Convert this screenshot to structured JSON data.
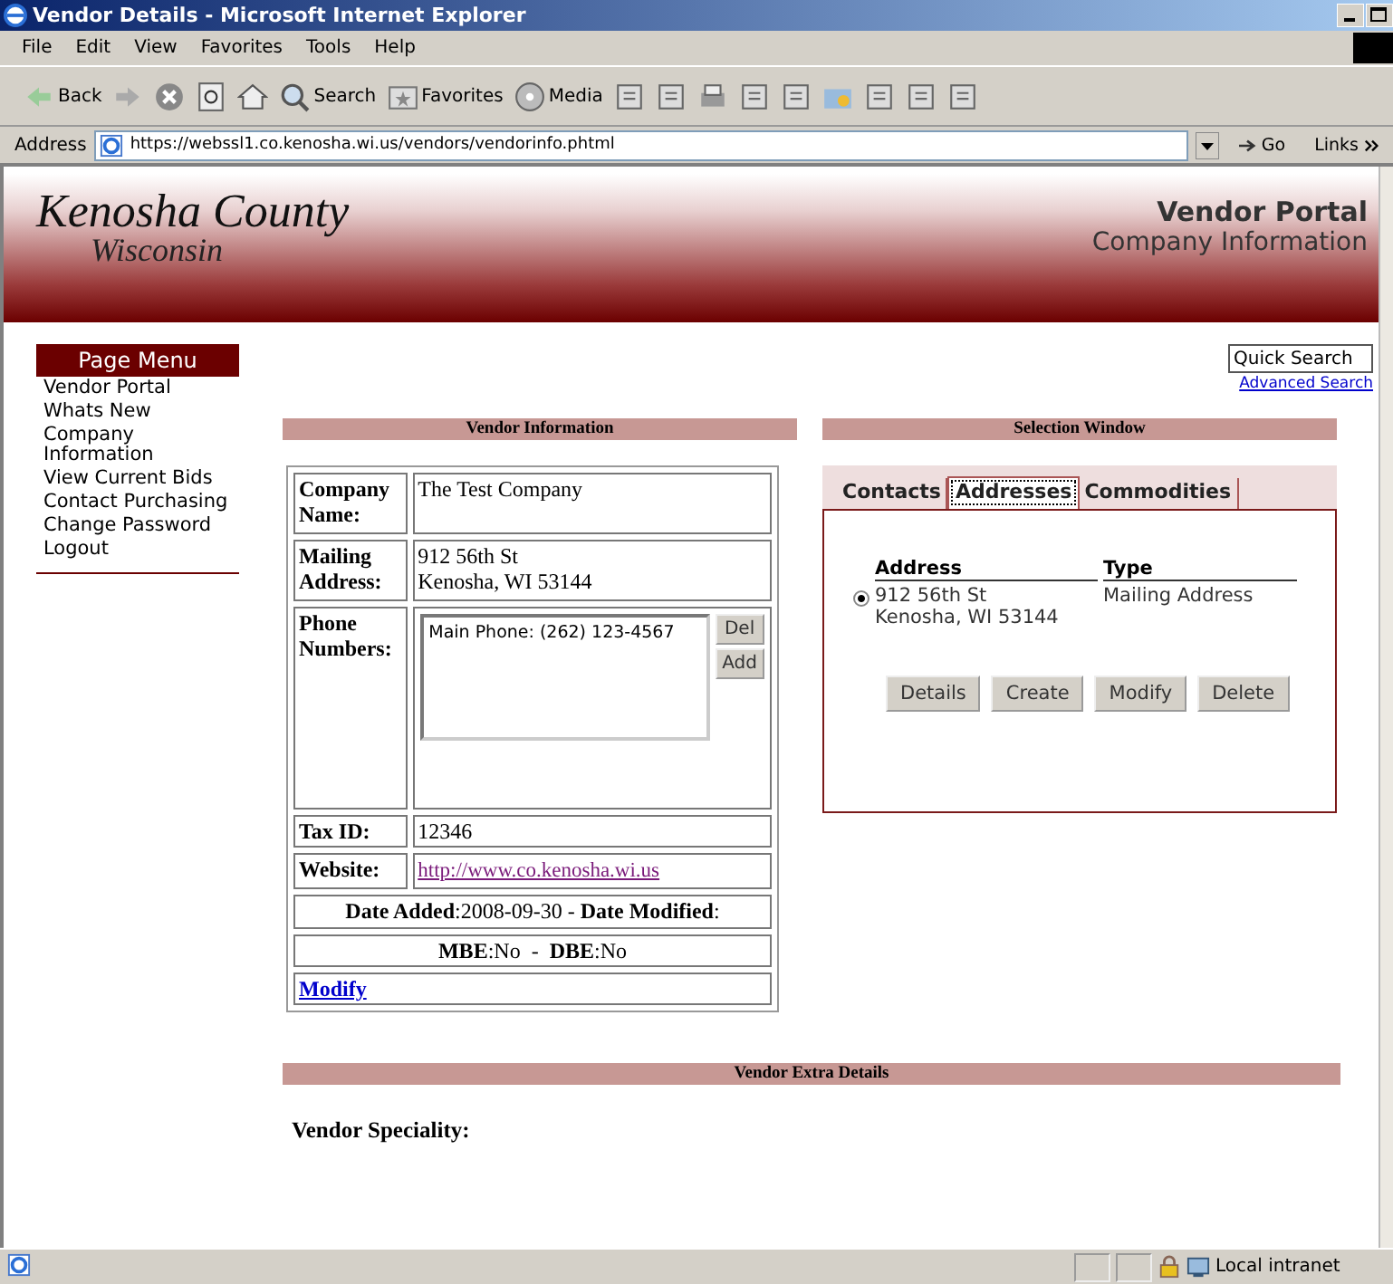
{
  "window": {
    "title": "Vendor Details - Microsoft Internet Explorer"
  },
  "menu": [
    "File",
    "Edit",
    "View",
    "Favorites",
    "Tools",
    "Help"
  ],
  "toolbar": [
    {
      "kind": "back",
      "label": "Back"
    },
    {
      "kind": "forward"
    },
    {
      "kind": "stop"
    },
    {
      "kind": "refresh"
    },
    {
      "kind": "home"
    },
    {
      "kind": "search",
      "label": "Search"
    },
    {
      "kind": "favorites",
      "label": "Favorites"
    },
    {
      "kind": "media",
      "label": "Media"
    },
    {
      "kind": "history"
    },
    {
      "kind": "mail"
    },
    {
      "kind": "print"
    },
    {
      "kind": "edit"
    },
    {
      "kind": "discuss"
    },
    {
      "kind": "folder"
    },
    {
      "kind": "messenger"
    },
    {
      "kind": "research"
    },
    {
      "kind": "other"
    }
  ],
  "address": {
    "label": "Address",
    "url": "https://webssl1.co.kenosha.wi.us/vendors/vendorinfo.phtml",
    "go": "Go",
    "links": "Links"
  },
  "header": {
    "county": "Kenosha County",
    "state": "Wisconsin",
    "portal": "Vendor Portal",
    "section": "Company Information"
  },
  "page_menu": {
    "title": "Page Menu",
    "items": [
      "Vendor Portal",
      "Whats New",
      "Company Information",
      "View Current Bids",
      "Contact Purchasing",
      "Change Password",
      "Logout"
    ]
  },
  "quick_search": {
    "placeholder": "Quick Search",
    "advanced": "Advanced Search"
  },
  "vendor_info": {
    "title": "Vendor Information",
    "fields": [
      {
        "label": "Company Name:",
        "value": "The Test Company"
      },
      {
        "label": "Mailing Address:",
        "value": "912 56th St\nKenosha, WI 53144"
      }
    ],
    "phone": {
      "label": "Phone Numbers:",
      "entries": [
        "Main Phone: (262) 123-4567"
      ],
      "buttons": [
        "Del",
        "Add"
      ]
    },
    "fields2": [
      {
        "label": "Tax ID:",
        "value": "12346",
        "kind": "text"
      },
      {
        "label": "Website:",
        "value": "http://www.co.kenosha.wi.us",
        "kind": "link"
      }
    ],
    "dates": "**Date Added**:2008-09-30 - **Date Modified**:",
    "flags": "**MBE**:No  -  **DBE**:No",
    "modify": "Modify"
  },
  "selection": {
    "title": "Selection Window",
    "tabs": [
      {
        "label": "Contacts",
        "selected": false
      },
      {
        "label": "Addresses",
        "selected": true
      },
      {
        "label": "Commodities",
        "selected": false
      }
    ],
    "columns": [
      "Address",
      "Type"
    ],
    "rows": [
      {
        "address": "912 56th St\nKenosha, WI 53144",
        "type": "Mailing Address",
        "selected": true
      }
    ],
    "buttons": [
      "Details",
      "Create",
      "Modify",
      "Delete"
    ]
  },
  "extra": {
    "title": "Vendor Extra Details",
    "label": "Vendor Speciality:"
  },
  "status_bar": {
    "zone": "Local intranet"
  }
}
